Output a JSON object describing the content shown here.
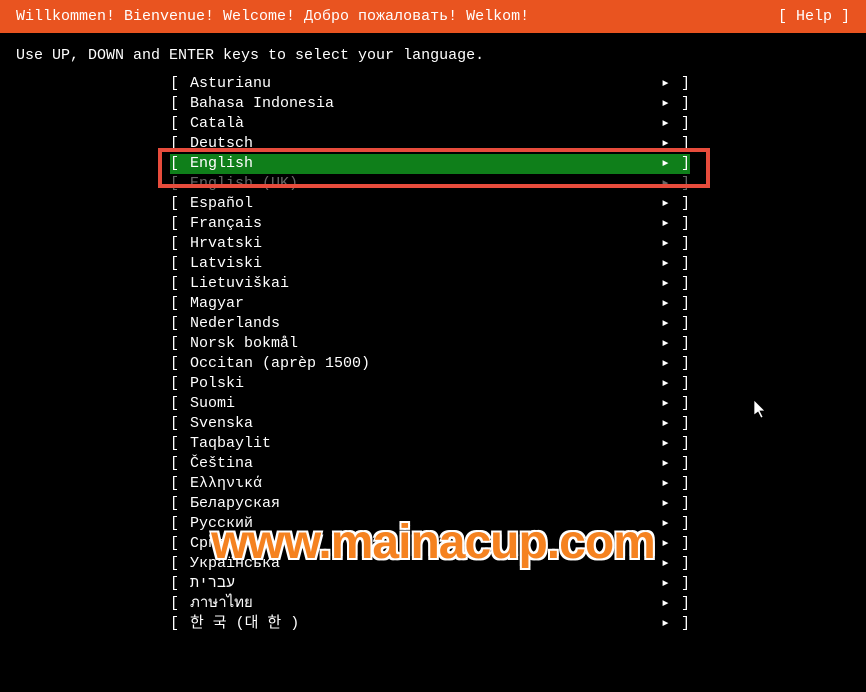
{
  "header": {
    "welcome": "Willkommen! Bienvenue! Welcome! Добро пожаловать! Welkom!",
    "help": "[ Help ]"
  },
  "instruction": "Use UP, DOWN and ENTER keys to select your language.",
  "bracket_left": "[",
  "bracket_right": "]",
  "arrow": "▸",
  "languages": [
    {
      "label": "Asturianu",
      "selected": false,
      "dimmed": false
    },
    {
      "label": "Bahasa Indonesia",
      "selected": false,
      "dimmed": false
    },
    {
      "label": "Català",
      "selected": false,
      "dimmed": false
    },
    {
      "label": "Deutsch",
      "selected": false,
      "dimmed": false
    },
    {
      "label": "English",
      "selected": true,
      "dimmed": false
    },
    {
      "label": "English (UK)",
      "selected": false,
      "dimmed": true
    },
    {
      "label": "Español",
      "selected": false,
      "dimmed": false
    },
    {
      "label": "Français",
      "selected": false,
      "dimmed": false
    },
    {
      "label": "Hrvatski",
      "selected": false,
      "dimmed": false
    },
    {
      "label": "Latviski",
      "selected": false,
      "dimmed": false
    },
    {
      "label": "Lietuviškai",
      "selected": false,
      "dimmed": false
    },
    {
      "label": "Magyar",
      "selected": false,
      "dimmed": false
    },
    {
      "label": "Nederlands",
      "selected": false,
      "dimmed": false
    },
    {
      "label": "Norsk bokmål",
      "selected": false,
      "dimmed": false
    },
    {
      "label": "Occitan (aprèp 1500)",
      "selected": false,
      "dimmed": false
    },
    {
      "label": "Polski",
      "selected": false,
      "dimmed": false
    },
    {
      "label": "Suomi",
      "selected": false,
      "dimmed": false
    },
    {
      "label": "Svenska",
      "selected": false,
      "dimmed": false
    },
    {
      "label": "Taqbaylit",
      "selected": false,
      "dimmed": false
    },
    {
      "label": "Čeština",
      "selected": false,
      "dimmed": false
    },
    {
      "label": "Ελληνικά",
      "selected": false,
      "dimmed": false
    },
    {
      "label": "Беларуская",
      "selected": false,
      "dimmed": false
    },
    {
      "label": "Русский",
      "selected": false,
      "dimmed": false
    },
    {
      "label": "Српски",
      "selected": false,
      "dimmed": false
    },
    {
      "label": "Українська",
      "selected": false,
      "dimmed": false
    },
    {
      "label": "עברית",
      "selected": false,
      "dimmed": false
    },
    {
      "label": "ภาษาไทย",
      "selected": false,
      "dimmed": false
    },
    {
      "label": "한 국 (대 한 )",
      "selected": false,
      "dimmed": false
    }
  ],
  "watermark": "www.mainacup.com"
}
